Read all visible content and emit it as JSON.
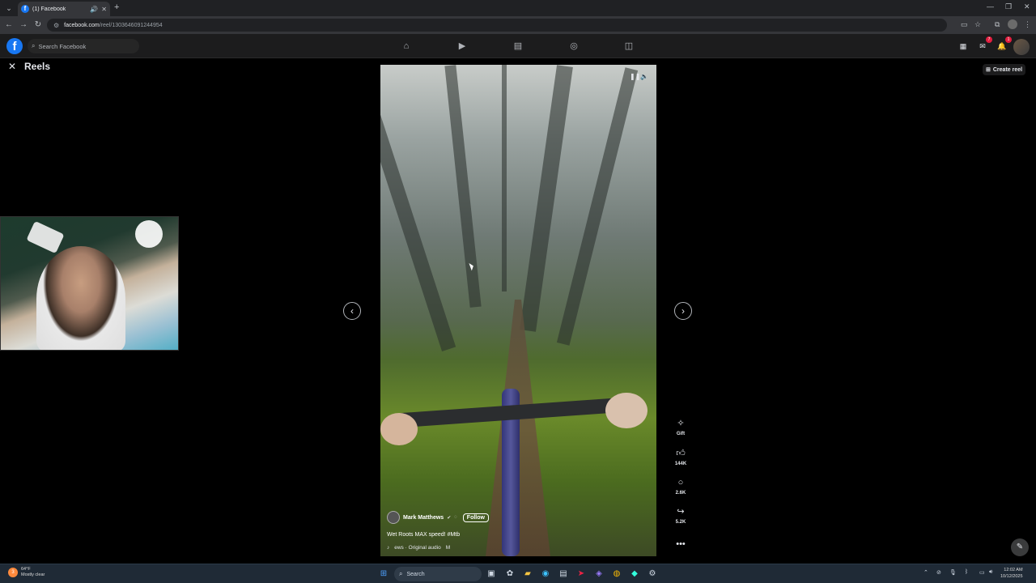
{
  "browser": {
    "tab": {
      "title": "(1) Facebook",
      "favicon": "facebook-icon",
      "audio_icon": "speaker-icon"
    },
    "address": {
      "site_icon": "site-info-icon",
      "domain": "facebook.com",
      "path": "/reel/1303646091244954"
    }
  },
  "facebook": {
    "logo": "f",
    "search": {
      "placeholder": "Search Facebook"
    },
    "nav_icons": [
      "home-icon",
      "video-icon",
      "marketplace-icon",
      "groups-icon",
      "gaming-icon"
    ],
    "right_icons": {
      "messenger_badge": "7",
      "notifications_badge": "1"
    },
    "reels": {
      "title": "Reels",
      "create_reel": "Create reel"
    }
  },
  "reel": {
    "creator": "Mark Matthews",
    "follow_label": "Follow",
    "caption": "Wet Roots MAX speed!  #Mtb",
    "audio": "ews · Original audio",
    "audio_extra": "M",
    "actions": {
      "gift": "Gift",
      "likes": "144K",
      "comments": "2.6K",
      "shares": "5.2K"
    }
  },
  "taskbar": {
    "weather": {
      "temp": "64°F",
      "condition": "Mostly clear",
      "alert": "3"
    },
    "search_placeholder": "Search",
    "clock": {
      "time": "12:02 AM",
      "date": "10/12/2025"
    }
  }
}
